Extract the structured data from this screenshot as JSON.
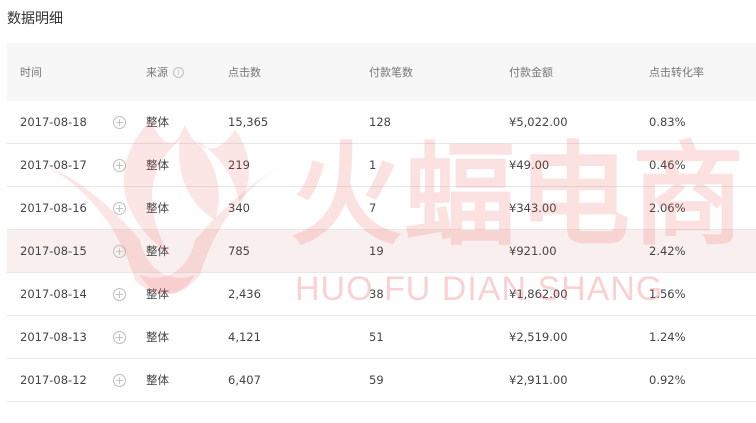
{
  "page": {
    "title": "数据明细"
  },
  "table": {
    "headers": {
      "time": "时间",
      "source": "来源",
      "clicks": "点击数",
      "payments": "付款笔数",
      "amount": "付款金额",
      "rate": "点击转化率"
    },
    "rows": [
      {
        "date": "2017-08-18",
        "source": "整体",
        "clicks": "15,365",
        "payments": "128",
        "amount": "¥5,022.00",
        "rate": "0.83%"
      },
      {
        "date": "2017-08-17",
        "source": "整体",
        "clicks": "219",
        "payments": "1",
        "amount": "¥49.00",
        "rate": "0.46%"
      },
      {
        "date": "2017-08-16",
        "source": "整体",
        "clicks": "340",
        "payments": "7",
        "amount": "¥343.00",
        "rate": "2.06%"
      },
      {
        "date": "2017-08-15",
        "source": "整体",
        "clicks": "785",
        "payments": "19",
        "amount": "¥921.00",
        "rate": "2.42%"
      },
      {
        "date": "2017-08-14",
        "source": "整体",
        "clicks": "2,436",
        "payments": "38",
        "amount": "¥1,862.00",
        "rate": "1.56%"
      },
      {
        "date": "2017-08-13",
        "source": "整体",
        "clicks": "4,121",
        "payments": "51",
        "amount": "¥2,519.00",
        "rate": "1.24%"
      },
      {
        "date": "2017-08-12",
        "source": "整体",
        "clicks": "6,407",
        "payments": "59",
        "amount": "¥2,911.00",
        "rate": "0.92%"
      }
    ]
  },
  "icons": {
    "expand": "plus-circle-icon",
    "info": "info-icon"
  },
  "watermark": {
    "cn": "火蝠电商",
    "en": "HUO FU DIAN SHANG"
  },
  "colors": {
    "highlight_row": "#f9efee",
    "header_bg": "#f7f7f7",
    "watermark": "#e85a5a"
  }
}
